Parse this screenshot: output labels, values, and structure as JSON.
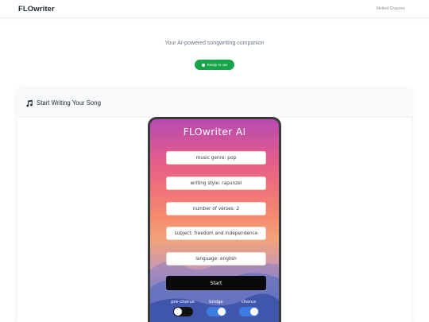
{
  "header": {
    "brand": "FLOwriter",
    "account": "Melted Crayons"
  },
  "hero": {
    "tagline": "Your AI-powered songwriting companion",
    "status": "Ready to use",
    "status_color": "#16a34a"
  },
  "card": {
    "title": "Start Writing Your Song",
    "icon": "music-note-icon"
  },
  "app": {
    "title": "FLOwriter AI",
    "fields": [
      {
        "value": "music genre: pop"
      },
      {
        "value": "writing style: rapunzel"
      },
      {
        "value": "number of verses: 2"
      },
      {
        "value": "subject: freedom and independence"
      },
      {
        "value": "language: english"
      }
    ],
    "start_label": "Start",
    "toggles": [
      {
        "label": "pre-chorus",
        "on": false
      },
      {
        "label": "bridge",
        "on": true
      },
      {
        "label": "chorus",
        "on": true
      }
    ],
    "toggle_on_color": "#3e7bde"
  }
}
